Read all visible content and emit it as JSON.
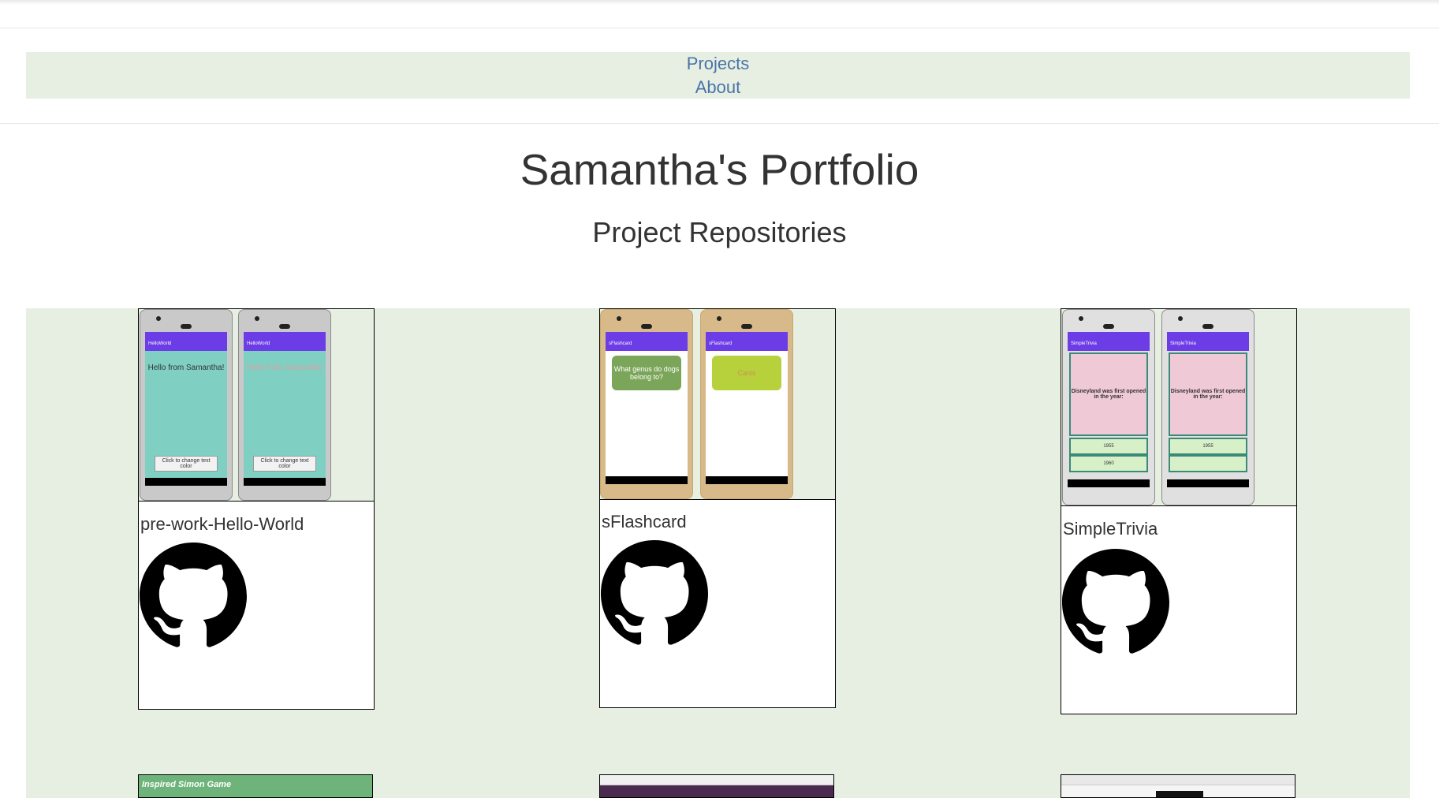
{
  "nav": {
    "links": [
      "Projects",
      "About"
    ]
  },
  "header": {
    "title": "Samantha's Portfolio",
    "subtitle": "Project Repositories"
  },
  "projects": [
    {
      "name": "pre-work-Hello-World",
      "screen_text": [
        "Hello from Samantha!",
        "Hello from Samantha!"
      ],
      "button_text": "Click to change text color",
      "app_title": "HelloWorld"
    },
    {
      "name": "sFlashcard",
      "screen_text": [
        "What genus do dogs belong to?",
        "Canis"
      ],
      "app_title": "sFlashcard"
    },
    {
      "name": "SimpleTrivia",
      "screen_text": [
        "Disneyland was first opened in the year:",
        "Disneyland was first opened in the year:"
      ],
      "options": [
        "1955",
        "1960"
      ],
      "app_title": "SimpleTrivia"
    }
  ],
  "bottom_row": [
    {
      "title": "Inspired Simon Game"
    },
    {
      "title": ""
    },
    {
      "title": ""
    }
  ],
  "colors": {
    "accent_bg": "#e6efe2",
    "link": "#4a74a8",
    "text": "#333333"
  },
  "icons": [
    "github-icon"
  ]
}
